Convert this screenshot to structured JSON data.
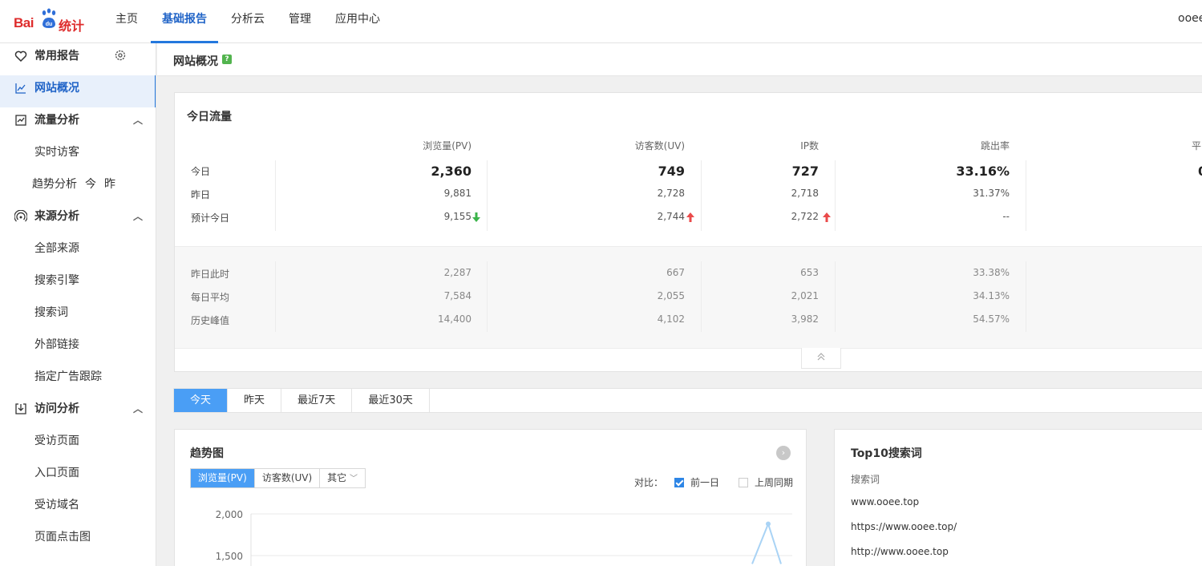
{
  "app": {
    "logo_latin": "Bai",
    "logo_cn": "统计",
    "user": "ooee"
  },
  "topnav": [
    {
      "label": "主页"
    },
    {
      "label": "基础报告"
    },
    {
      "label": "分析云"
    },
    {
      "label": "管理"
    },
    {
      "label": "应用中心"
    }
  ],
  "sidebar": {
    "favorites": "常用报告",
    "overview": "网站概况",
    "traffic": "流量分析",
    "realtime": "实时访客",
    "trend": "趋势分析",
    "trend_today": "今",
    "trend_yesterday": "昨",
    "source": "来源分析",
    "all_sources": "全部来源",
    "search_engine": "搜索引擎",
    "search_words": "搜索词",
    "external_links": "外部链接",
    "ad_tracking": "指定广告跟踪",
    "visit": "访问分析",
    "visited_pages": "受访页面",
    "entry_pages": "入口页面",
    "visited_domains": "受访域名",
    "click_map": "页面点击图"
  },
  "page": {
    "title": "网站概况",
    "help": "?"
  },
  "today": {
    "title": "今日流量",
    "columns": [
      "浏览量(PV)",
      "访客数(UV)",
      "IP数",
      "跳出率",
      "平"
    ],
    "rows": [
      {
        "label": "今日",
        "values": [
          "2,360",
          "749",
          "727",
          "33.16%",
          "0"
        ]
      },
      {
        "label": "昨日",
        "values": [
          "9,881",
          "2,728",
          "2,718",
          "31.37%"
        ]
      },
      {
        "label": "预计今日",
        "values": [
          "9,155",
          "2,744",
          "2,722",
          "--"
        ]
      }
    ],
    "lower_rows": [
      {
        "label": "昨日此时",
        "values": [
          "2,287",
          "667",
          "653",
          "33.38%"
        ]
      },
      {
        "label": "每日平均",
        "values": [
          "7,584",
          "2,055",
          "2,021",
          "34.13%"
        ]
      },
      {
        "label": "历史峰值",
        "values": [
          "14,400",
          "4,102",
          "3,982",
          "54.57%"
        ]
      }
    ],
    "colors": {
      "down": "#3cb44b",
      "up": "#ea4a4a"
    }
  },
  "tabs": [
    {
      "label": "今天"
    },
    {
      "label": "昨天"
    },
    {
      "label": "最近7天"
    },
    {
      "label": "最近30天"
    }
  ],
  "trend": {
    "title": "趋势图",
    "metrics": [
      "浏览量(PV)",
      "访客数(UV)",
      "其它"
    ],
    "compare_label": "对比：",
    "compare_prev_day": "前一日",
    "compare_last_week": "上周同期"
  },
  "chart_data": {
    "type": "line",
    "title": "",
    "yticks": [
      "2,000",
      "1,500"
    ],
    "ylim": [
      1500,
      2000
    ],
    "series": [
      {
        "values": [
          1880,
          1400
        ]
      }
    ]
  },
  "top10": {
    "title": "Top10搜索词",
    "column": "搜索词",
    "items": [
      "www.ooee.top",
      "https://www.ooee.top/",
      "http://www.ooee.top"
    ]
  }
}
